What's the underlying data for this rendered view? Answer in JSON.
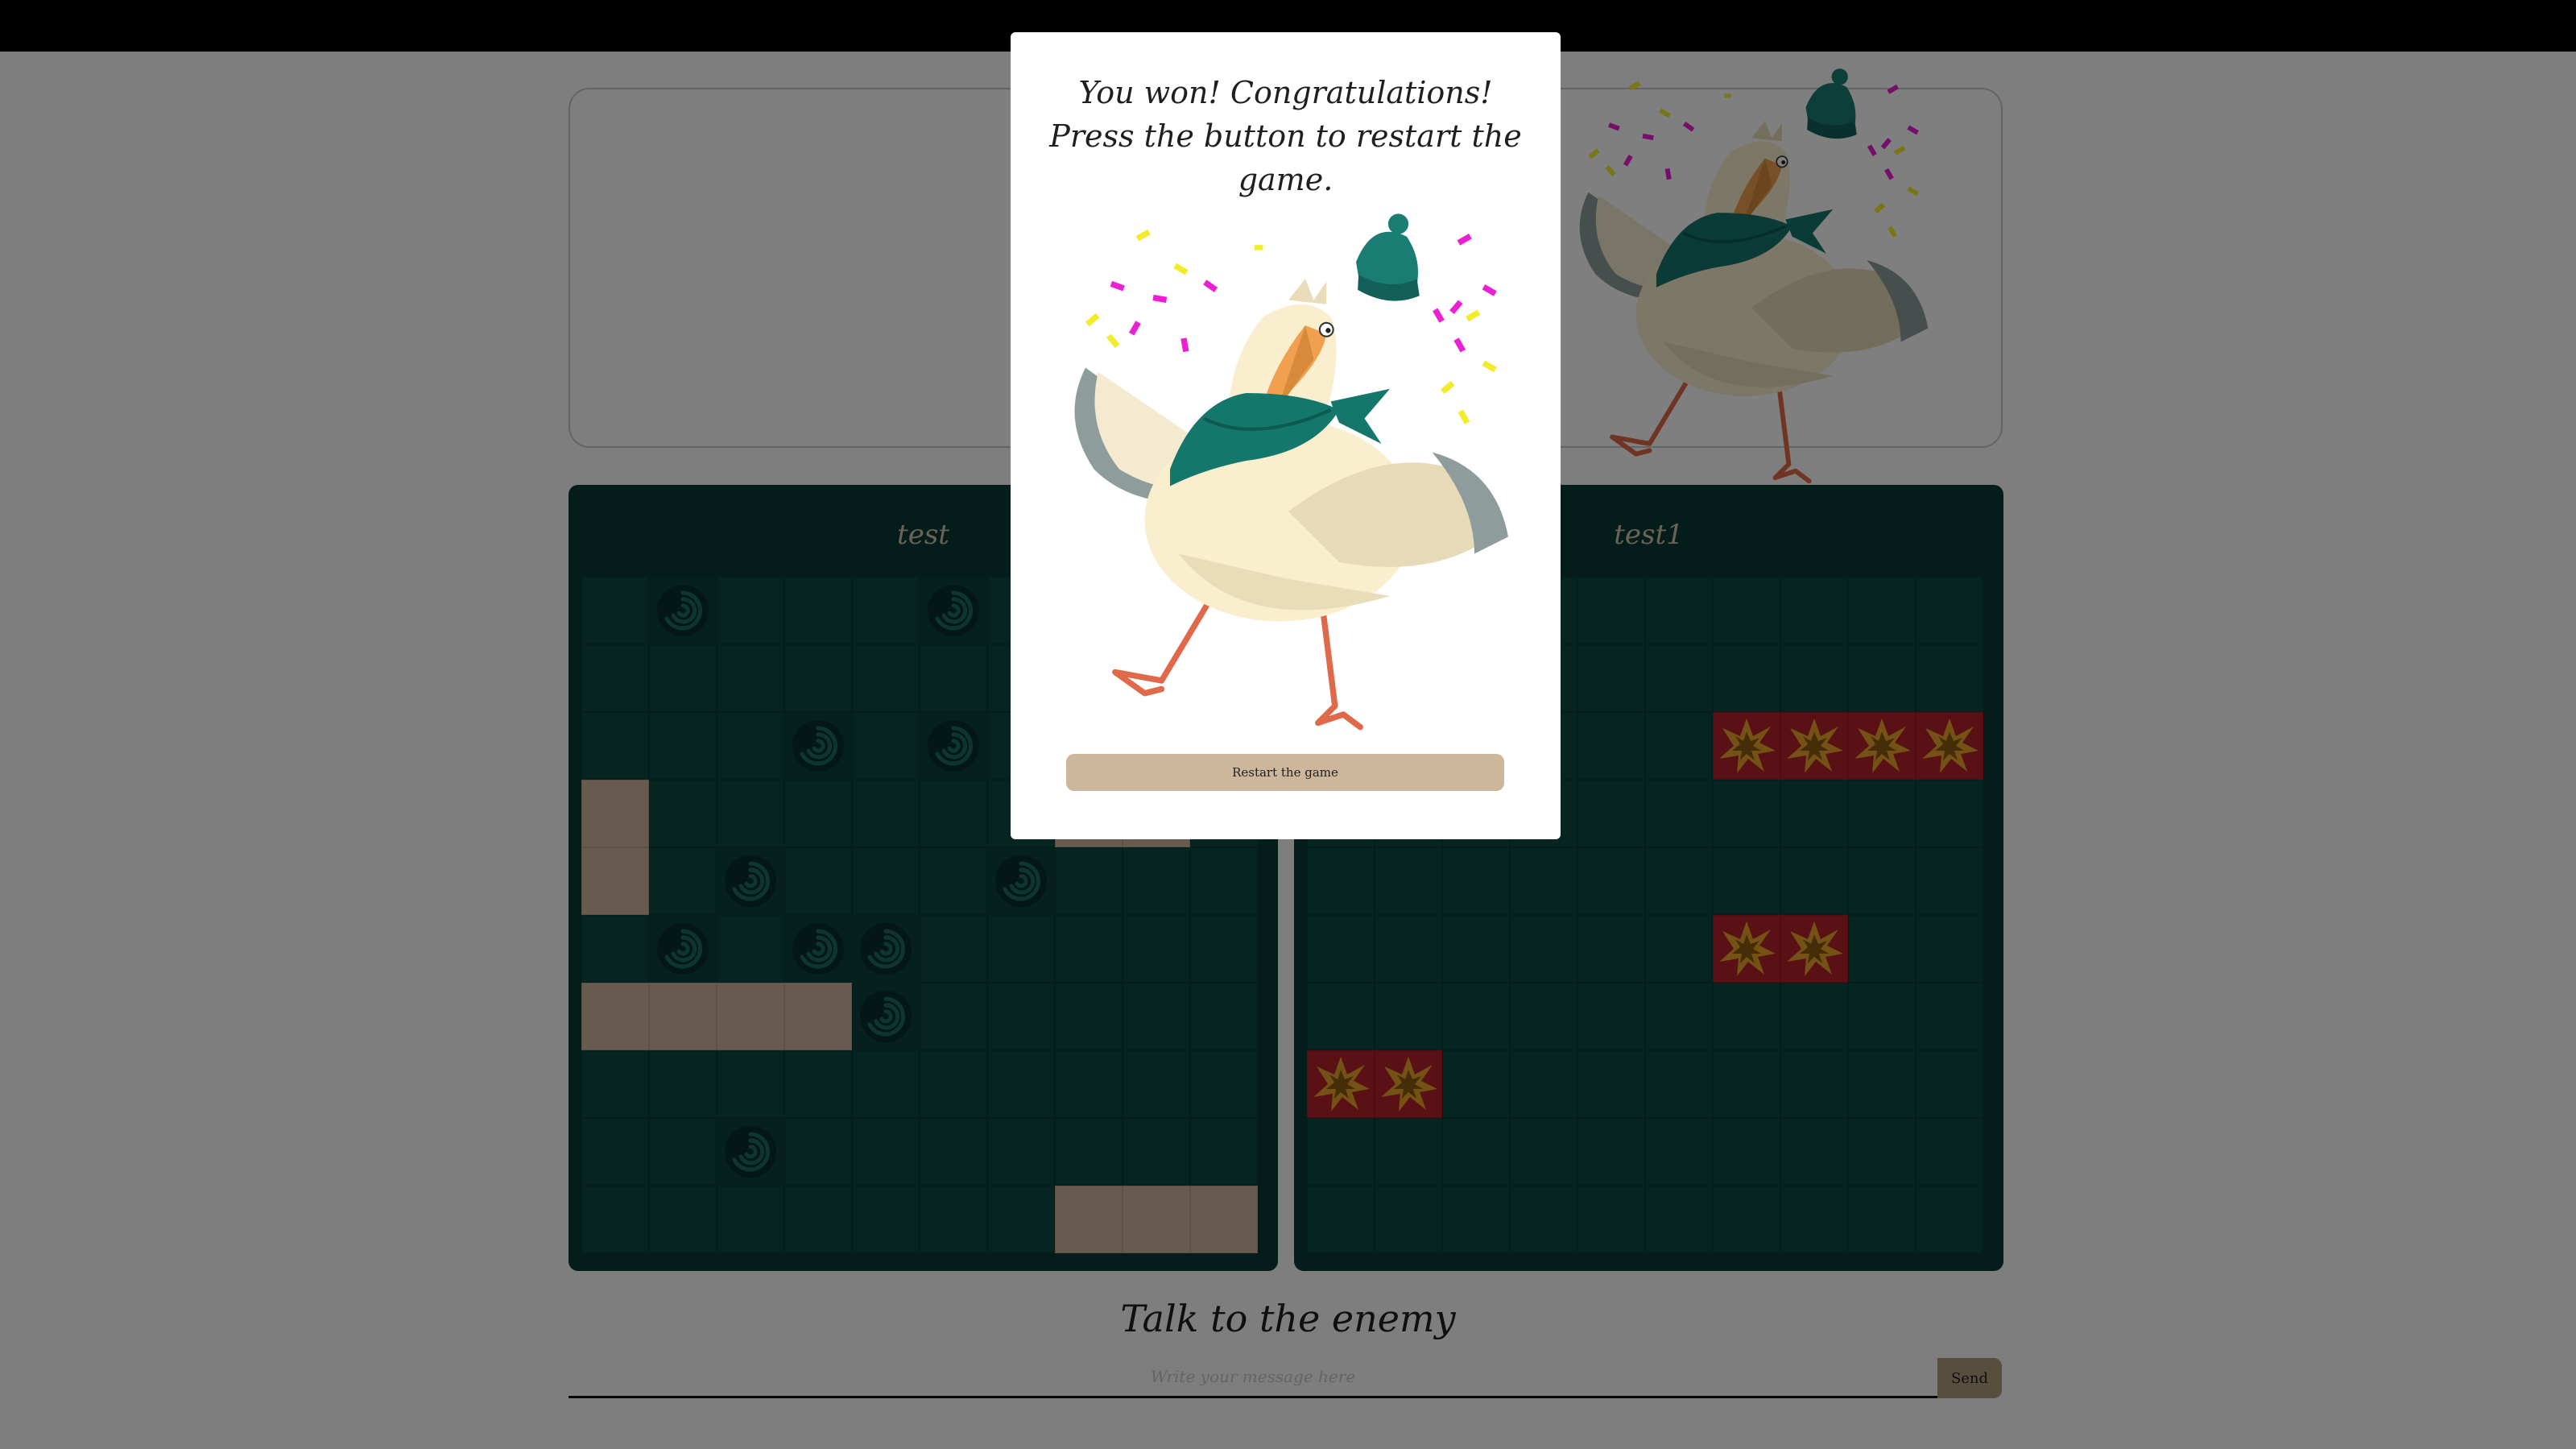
{
  "boards": {
    "player": {
      "name": "test",
      "rows": [
        [
          "",
          "miss",
          "",
          "",
          "",
          "miss",
          "",
          "",
          "",
          ""
        ],
        [
          "",
          "",
          "",
          "",
          "",
          "",
          "",
          "",
          "",
          ""
        ],
        [
          "",
          "",
          "",
          "miss",
          "",
          "miss",
          "",
          "",
          "",
          ""
        ],
        [
          "ship",
          "",
          "",
          "",
          "",
          "",
          "",
          "ship",
          "ship",
          ""
        ],
        [
          "ship",
          "",
          "miss",
          "",
          "",
          "",
          "miss",
          "",
          "",
          ""
        ],
        [
          "",
          "miss",
          "",
          "miss",
          "miss",
          "",
          "",
          "",
          "",
          ""
        ],
        [
          "ship",
          "ship",
          "ship",
          "ship",
          "miss",
          "",
          "",
          "",
          "",
          ""
        ],
        [
          "",
          "",
          "",
          "",
          "",
          "",
          "",
          "",
          "",
          ""
        ],
        [
          "",
          "",
          "miss",
          "",
          "",
          "",
          "",
          "",
          "",
          ""
        ],
        [
          "",
          "",
          "",
          "",
          "",
          "",
          "",
          "ship",
          "ship",
          "ship"
        ]
      ]
    },
    "enemy": {
      "name": "test1",
      "rows": [
        [
          "",
          "",
          "",
          "",
          "",
          "",
          "",
          "",
          "",
          ""
        ],
        [
          "",
          "",
          "",
          "",
          "",
          "",
          "",
          "",
          "",
          ""
        ],
        [
          "",
          "",
          "",
          "",
          "",
          "",
          "hit",
          "hit",
          "hit",
          "hit"
        ],
        [
          "",
          "",
          "",
          "",
          "",
          "",
          "",
          "",
          "",
          ""
        ],
        [
          "",
          "",
          "",
          "",
          "",
          "",
          "",
          "",
          "",
          ""
        ],
        [
          "",
          "",
          "",
          "",
          "",
          "",
          "hit",
          "hit",
          "",
          ""
        ],
        [
          "",
          "",
          "",
          "",
          "",
          "",
          "",
          "",
          "",
          ""
        ],
        [
          "hit",
          "hit",
          "",
          "",
          "",
          "",
          "",
          "",
          "",
          ""
        ],
        [
          "",
          "",
          "",
          "",
          "",
          "",
          "",
          "",
          "",
          ""
        ],
        [
          "",
          "",
          "",
          "",
          "",
          "",
          "",
          "",
          "",
          ""
        ]
      ]
    }
  },
  "chat": {
    "title": "Talk to the enemy",
    "placeholder": "Write your message here",
    "send_label": "Send"
  },
  "modal": {
    "message": "You won! Congratulations! Press the button to restart the game.",
    "button_label": "Restart the game"
  },
  "colors": {
    "board": "#093a35",
    "cell": "#0c4a43",
    "ship": "#ccb79c",
    "hit": "#b5232a",
    "button": "#ccb79c"
  },
  "icons": {
    "miss": "whirlpool-icon",
    "hit": "explosion-icon"
  }
}
